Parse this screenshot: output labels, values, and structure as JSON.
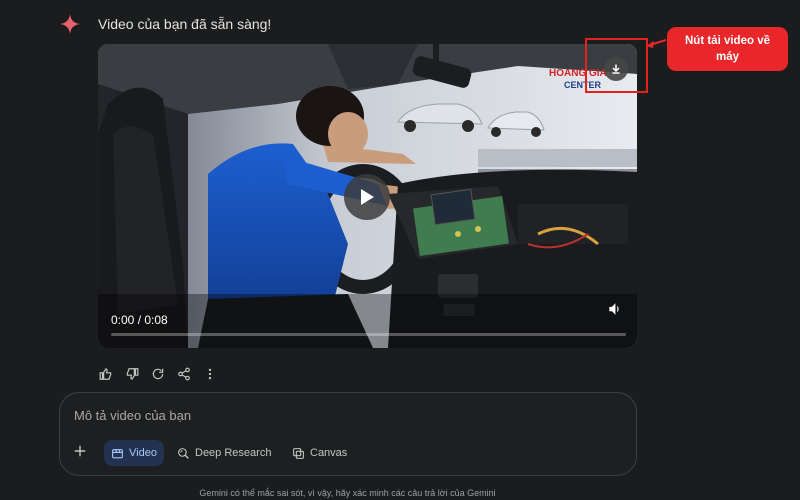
{
  "message": {
    "title": "Video của bạn đã sẵn sàng!"
  },
  "video": {
    "time": "0:00 / 0:08",
    "progress": 0,
    "brand_line1": "HOANG GIA",
    "brand_line2": "CENTER"
  },
  "annotation": {
    "callout": "Nút tải video về máy"
  },
  "actions": [
    "thumb-up-icon",
    "thumb-down-icon",
    "regenerate-icon",
    "share-icon",
    "more-icon"
  ],
  "composer": {
    "placeholder": "Mô tả video của bạn",
    "chips": {
      "video": "Video",
      "deep_research": "Deep Research",
      "canvas": "Canvas"
    }
  },
  "footer": "Gemini có thể mắc sai sót, vì vậy, hãy xác minh các câu trả lời của Gemini",
  "colors": {
    "background": "#1b1c1d",
    "accent": "#a8c7fa",
    "annotation_red": "#e9262a"
  }
}
